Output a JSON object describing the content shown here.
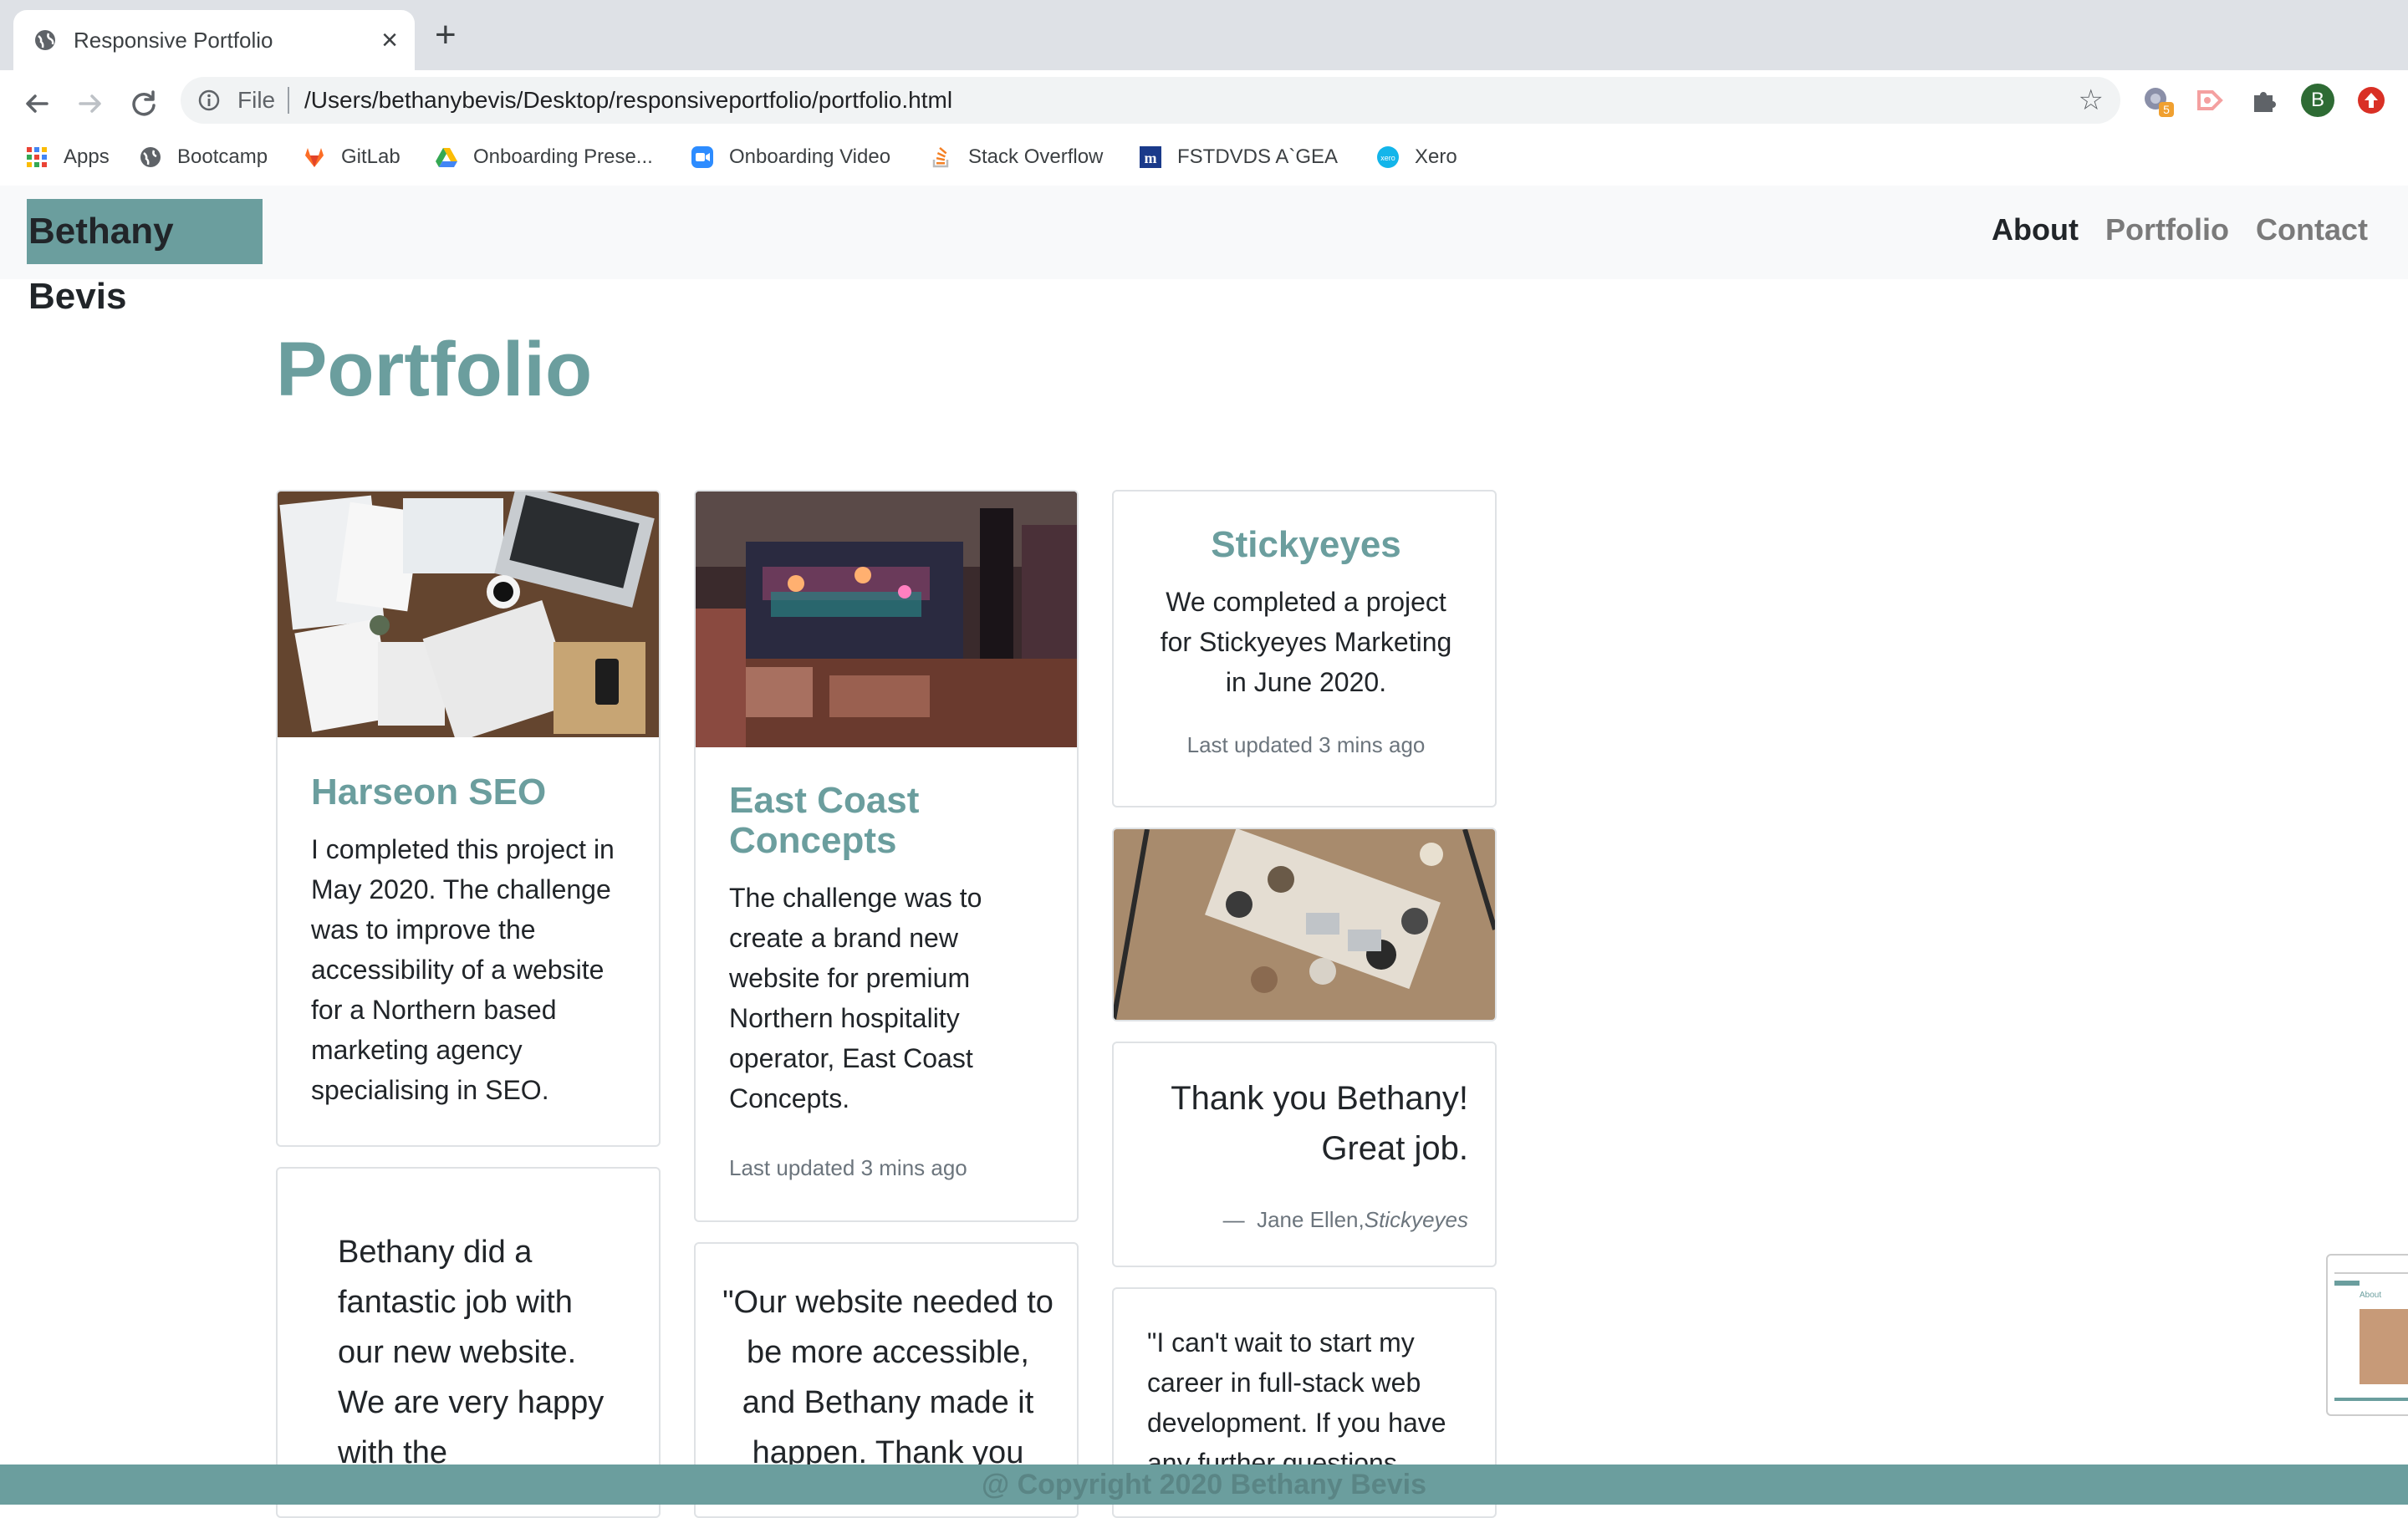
{
  "browser": {
    "tab_title": "Responsive Portfolio",
    "new_tab": "+",
    "close": "×",
    "omnibox_file": "File",
    "url": "/Users/bethanybevis/Desktop/responsiveportfolio/portfolio.html",
    "profile_initial": "B",
    "ext_badge": "5",
    "bookmarks": [
      {
        "label": "Apps",
        "icon": "apps-grid-icon"
      },
      {
        "label": "Bootcamp",
        "icon": "globe-icon"
      },
      {
        "label": "GitLab",
        "icon": "gitlab-icon"
      },
      {
        "label": "Onboarding Prese...",
        "icon": "google-drive-icon"
      },
      {
        "label": "Onboarding Video",
        "icon": "zoom-icon"
      },
      {
        "label": "Stack Overflow",
        "icon": "stackoverflow-icon"
      },
      {
        "label": "FSTDVDS A`GEA",
        "icon": "m-icon"
      },
      {
        "label": "Xero",
        "icon": "xero-icon"
      }
    ]
  },
  "site": {
    "brand": "Bethany Bevis",
    "nav": [
      {
        "label": "About",
        "active": true
      },
      {
        "label": "Portfolio",
        "active": false
      },
      {
        "label": "Contact",
        "active": false
      }
    ],
    "page_title": "Portfolio",
    "accent": "#6b9e9e",
    "cards": {
      "harseon": {
        "title": "Harseon SEO",
        "text": "I completed this project in May 2020. The challenge was to improve the accessibility of a website for a Northern based marketing agency specialising in SEO."
      },
      "quote1": {
        "text": "Bethany did a fantastic job with our new website. We are very happy with the"
      },
      "eastcoast": {
        "title": "East Coast Concepts",
        "text": "The challenge was to create a brand new website for premium Northern hospitality operator, East Coast Concepts.",
        "updated": "Last updated 3 mins ago"
      },
      "quote2": {
        "text": "\"Our website needed to be more accessible, and Bethany made it happen. Thank you"
      },
      "stickyeyes": {
        "title": "Stickyeyes",
        "text": "We completed a project for Stickyeyes Marketing in June 2020.",
        "updated": "Last updated 3 mins ago"
      },
      "thanks": {
        "quote": "Thank you Bethany! Great job.",
        "dash": "—",
        "author": "Jane Ellen,",
        "source": "Stickyeyes"
      },
      "career": {
        "text": "\"I can't wait to start my career in full-stack web development. If you have any further questions"
      }
    },
    "footer": "@ Copyright 2020 Bethany Bevis",
    "thumb_label": "About"
  }
}
